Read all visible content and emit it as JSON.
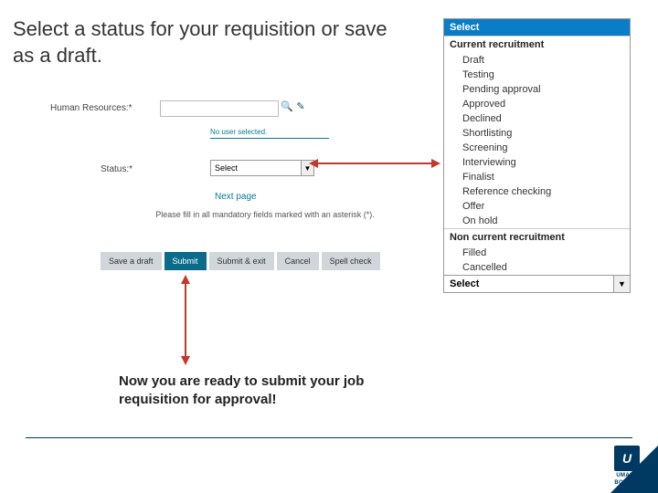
{
  "title": "Select a status for your requisition or save as a draft.",
  "form": {
    "hr_label": "Human Resources:*",
    "no_user": "No user selected.",
    "status_label": "Status:*",
    "status_value": "Select",
    "next_page": "Next page",
    "mandatory": "Please fill in all mandatory fields marked with an asterisk (*).",
    "buttons": {
      "save_draft": "Save a draft",
      "submit": "Submit",
      "submit_exit": "Submit & exit",
      "cancel": "Cancel",
      "spell_check": "Spell check"
    }
  },
  "dropdown": {
    "header": "Select",
    "group1": "Current recruitment",
    "items1": [
      "Draft",
      "Testing",
      "Pending approval",
      "Approved",
      "Declined",
      "Shortlisting",
      "Screening",
      "Interviewing",
      "Finalist",
      "Reference checking",
      "Offer",
      "On hold"
    ],
    "group2": "Non current recruitment",
    "items2": [
      "Filled",
      "Cancelled"
    ],
    "footer": "Select"
  },
  "caption": "Now you are ready to submit your job requisition for approval!",
  "logo": {
    "mark": "U",
    "line1": "UMASS",
    "line2": "BOSTON"
  }
}
